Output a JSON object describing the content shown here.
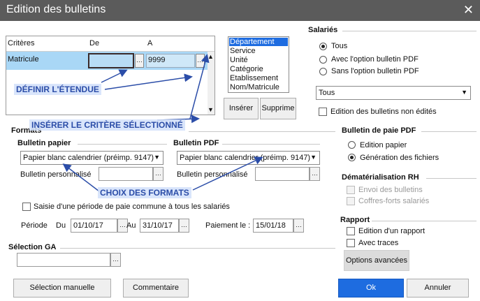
{
  "window": {
    "title": "Edition des bulletins"
  },
  "criteria": {
    "headers": [
      "Critères",
      "De",
      "A"
    ],
    "row": {
      "label": "Matricule",
      "de": "",
      "a": "9999"
    }
  },
  "criteria_list": [
    "Département",
    "Service",
    "Unité",
    "Catégorie",
    "Etablissement",
    "Nom/Matricule"
  ],
  "buttons": {
    "insert": "Insérer",
    "delete": "Supprime",
    "manual_selection": "Sélection manuelle",
    "comment": "Commentaire",
    "advanced": "Options avancées",
    "ok": "Ok",
    "cancel": "Annuler"
  },
  "salaries": {
    "label": "Salariés",
    "options": [
      "Tous",
      "Avec l'option bulletin PDF",
      "Sans l'option bulletin PDF"
    ],
    "selected": 0,
    "filter": "Tous",
    "non_edited": "Edition des bulletins non édités"
  },
  "formats": {
    "label": "Formats",
    "paper": {
      "label": "Bulletin papier",
      "value": "Papier blanc calendrier (préimp. 9147)",
      "custom": "Bulletin personnalisé"
    },
    "pdf": {
      "label": "Bulletin PDF",
      "value": "Papier blanc calendrier (préimp. 9147)",
      "custom": "Bulletin personnalisé"
    }
  },
  "period": {
    "common": "Saisie d'une période de paie commune à tous les salariés",
    "label": "Période",
    "from_label": "Du",
    "from": "01/10/17",
    "to_label": "Au",
    "to": "31/10/17",
    "payment_label": "Paiement le :",
    "payment": "15/01/18"
  },
  "ga": {
    "label": "Sélection GA",
    "value": ""
  },
  "pdf_payslip": {
    "label": "Bulletin de paie PDF",
    "options": [
      "Edition papier",
      "Génération des fichiers"
    ],
    "selected": 1
  },
  "dematerialisation": {
    "label": "Dématérialisation RH",
    "send": "Envoi des bulletins",
    "vaults": "Coffres-forts salariés"
  },
  "report": {
    "label": "Rapport",
    "edition": "Edition d'un rapport",
    "traces": "Avec traces"
  },
  "annotations": {
    "range": "DÉFINIR L'ÉTENDUE",
    "insert": "INSÉRER LE CRITÈRE SÉLECTIONNÉ",
    "formats": "CHOIX DES FORMATS"
  },
  "colors": {
    "accent": "#1e6ce0",
    "titlebar": "#5b5b5b",
    "row_highlight": "#a9d7f6",
    "annotation": "#2b4da8"
  }
}
